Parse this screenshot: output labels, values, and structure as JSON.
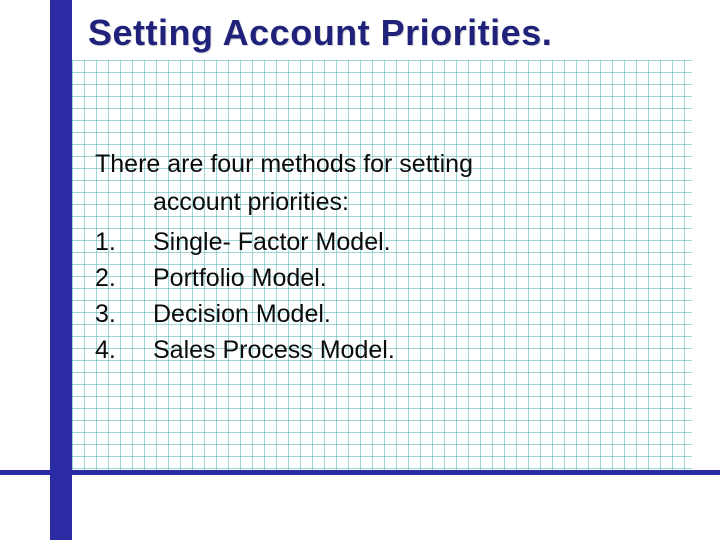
{
  "title": "Setting Account Priorities.",
  "intro": {
    "line1": "There are four methods for setting",
    "line2": "account priorities:"
  },
  "items": [
    {
      "num": "1.",
      "text": "Single- Factor Model."
    },
    {
      "num": "2.",
      "text": "Portfolio Model."
    },
    {
      "num": "3.",
      "text": "Decision Model."
    },
    {
      "num": "4.",
      "text": "Sales Process Model."
    }
  ]
}
